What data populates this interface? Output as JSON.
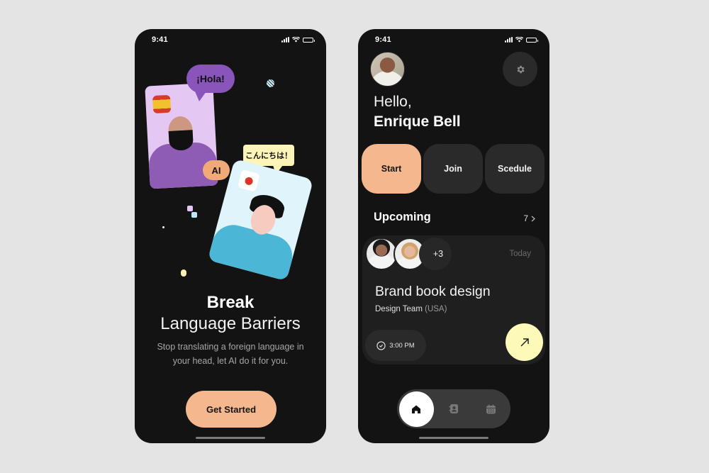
{
  "onboarding_screen": {
    "status_bar": {
      "time": "9:41"
    },
    "illustration": {
      "bubble_spanish": "¡Hola!",
      "bubble_japanese": "こんにちは！",
      "ai_badge": "AI",
      "icons": [
        "spain-flag-icon",
        "japan-flag-icon",
        "globe-icon",
        "translate-icon",
        "microphone-icon"
      ]
    },
    "title_bold": "Break",
    "title_regular": "Language Barriers",
    "subtitle": "Stop translating a foreign language in your head, let AI do it for you.",
    "cta_label": "Get Started",
    "colors": {
      "accent": "#f5b78d",
      "background": "#131313"
    }
  },
  "home_screen": {
    "status_bar": {
      "time": "9:41"
    },
    "greeting": "Hello,",
    "user_name": "Enrique Bell",
    "actions": [
      {
        "label": "Start",
        "primary": true
      },
      {
        "label": "Join",
        "primary": false
      },
      {
        "label": "Scedule",
        "primary": false
      }
    ],
    "upcoming": {
      "title": "Upcoming",
      "count": "7",
      "card": {
        "extra_participants": "+3",
        "date": "Today",
        "title": "Brand book design",
        "team": "Design Team",
        "region": "(USA)",
        "time": "3:00 PM"
      }
    },
    "tab_bar": [
      {
        "name": "home",
        "icon": "home-icon",
        "active": true
      },
      {
        "name": "contacts",
        "icon": "contacts-book-icon",
        "active": false
      },
      {
        "name": "calendar",
        "icon": "calendar-icon",
        "active": false
      }
    ],
    "colors": {
      "accent": "#f5b78d",
      "open_button": "#fdfab9",
      "card": "#1f1f1f"
    }
  }
}
